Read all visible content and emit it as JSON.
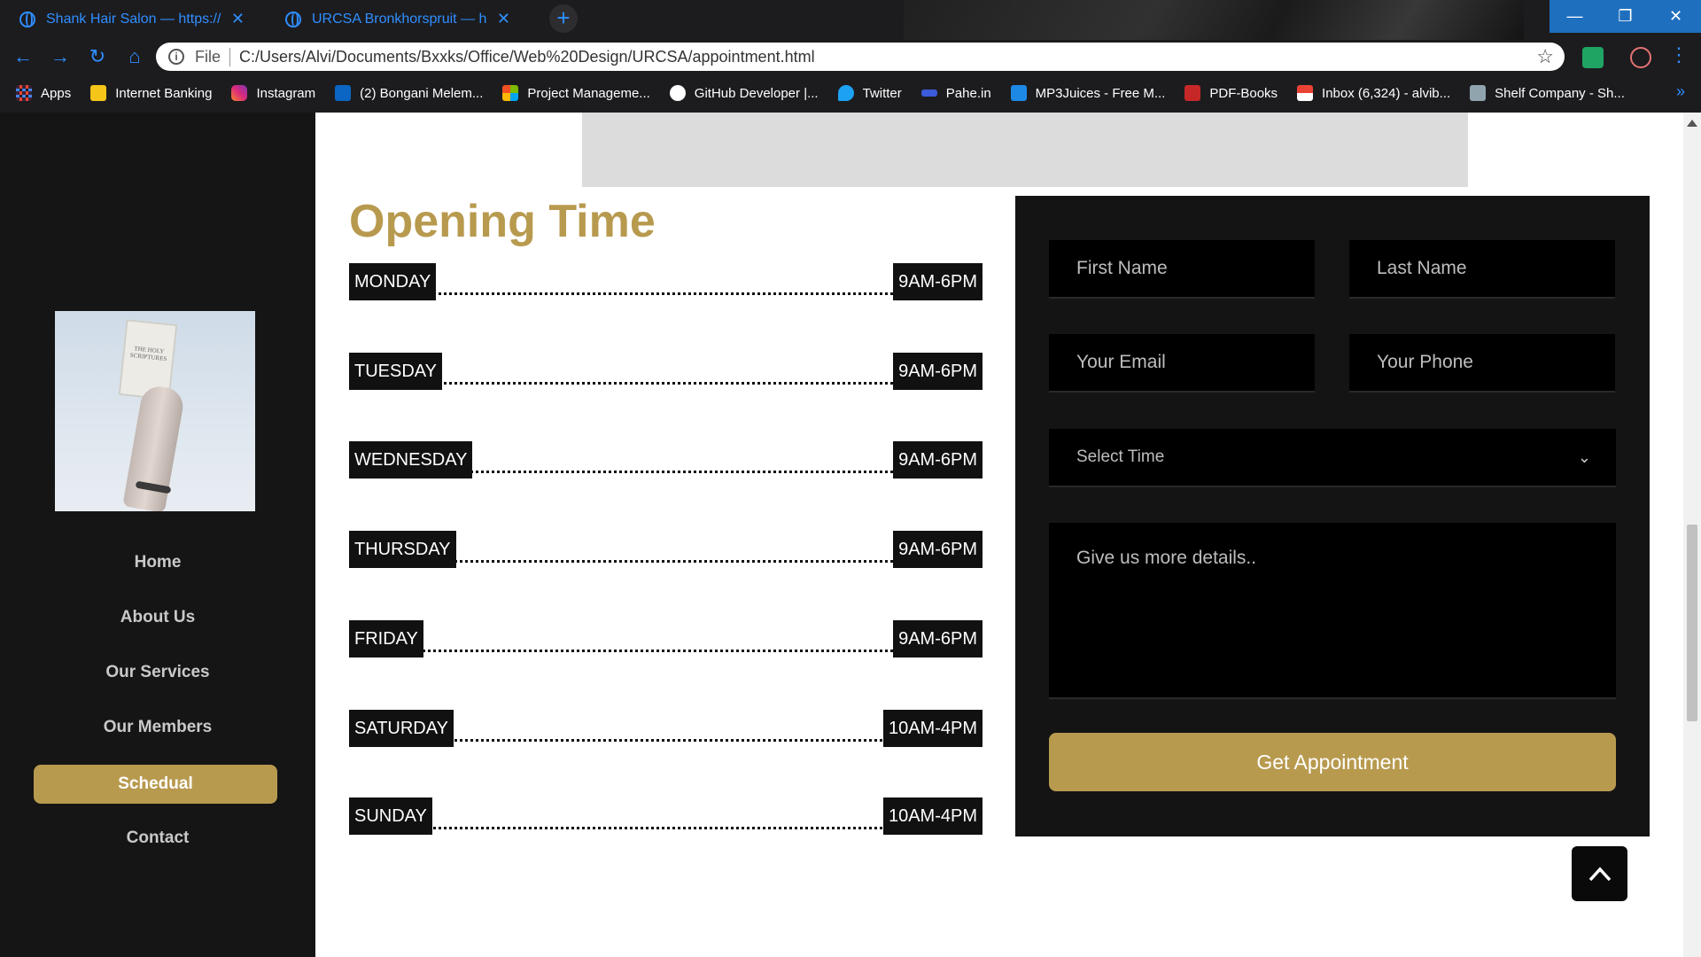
{
  "browser": {
    "tabs": [
      {
        "title": "Shank Hair Salon — https://www",
        "close": "✕"
      },
      {
        "title": "URCSA Bronkhorspruit — https:/",
        "close": "✕"
      }
    ],
    "new_tab": "+",
    "window_controls": {
      "minimize": "—",
      "restore": "❐",
      "close": "✕"
    },
    "nav": {
      "back": "←",
      "forward": "→",
      "reload": "↻",
      "home": "⌂"
    },
    "address": {
      "scheme": "File",
      "url": "C:/Users/Alvi/Documents/Bxxks/Office/Web%20Design/URCSA/appointment.html"
    },
    "menu": "⋮",
    "bookmarks": [
      {
        "label": "Apps",
        "icon": "apps-grid-icon",
        "color": "#4285f4"
      },
      {
        "label": "Internet Banking",
        "icon": "bank-icon",
        "color": "#f5c518"
      },
      {
        "label": "Instagram",
        "icon": "instagram-icon",
        "color": "#d62976"
      },
      {
        "label": "(2) Bongani Melem...",
        "icon": "linkedin-icon",
        "color": "#0a66c2"
      },
      {
        "label": "Project Manageme...",
        "icon": "microsoft-icon",
        "color": "#f25022"
      },
      {
        "label": "GitHub Developer |...",
        "icon": "github-icon",
        "color": "#ffffff"
      },
      {
        "label": "Twitter",
        "icon": "twitter-icon",
        "color": "#1da1f2"
      },
      {
        "label": "Pahe.in",
        "icon": "pahe-icon",
        "color": "#3b5bdb"
      },
      {
        "label": "MP3Juices - Free M...",
        "icon": "download-icon",
        "color": "#1e88e5"
      },
      {
        "label": "PDF-Books",
        "icon": "pdf-icon",
        "color": "#c62828"
      },
      {
        "label": "Inbox (6,324) - alvib...",
        "icon": "gmail-icon",
        "color": "#ea4335"
      },
      {
        "label": "Shelf Company - Sh...",
        "icon": "shelf-icon",
        "color": "#90a4ae"
      }
    ],
    "bookmarks_more": "»"
  },
  "sidebar": {
    "nav": [
      {
        "label": "Home"
      },
      {
        "label": "About Us"
      },
      {
        "label": "Our Services"
      },
      {
        "label": "Our Members"
      },
      {
        "label": "Schedual",
        "active": true
      },
      {
        "label": "Contact"
      }
    ],
    "profile_image_text": "THE HOLY SCRIPTURES"
  },
  "hours": {
    "title": "Opening Time",
    "days": [
      {
        "day": "MONDAY",
        "time": "9AM-6PM"
      },
      {
        "day": "TUESDAY",
        "time": "9AM-6PM"
      },
      {
        "day": "WEDNESDAY",
        "time": "9AM-6PM"
      },
      {
        "day": "THURSDAY",
        "time": "9AM-6PM"
      },
      {
        "day": "FRIDAY",
        "time": "9AM-6PM"
      },
      {
        "day": "SATURDAY",
        "time": "10AM-4PM"
      },
      {
        "day": "SUNDAY",
        "time": "10AM-4PM"
      }
    ]
  },
  "form": {
    "first_name": "First Name",
    "last_name": "Last Name",
    "email": "Your Email",
    "phone": "Your Phone",
    "select_time": "Select Time",
    "details": "Give us more details..",
    "submit": "Get Appointment"
  },
  "colors": {
    "accent": "#b89a4f",
    "sidebar": "#151515",
    "form_bg": "#141414",
    "browser_accent": "#2f8fff"
  }
}
